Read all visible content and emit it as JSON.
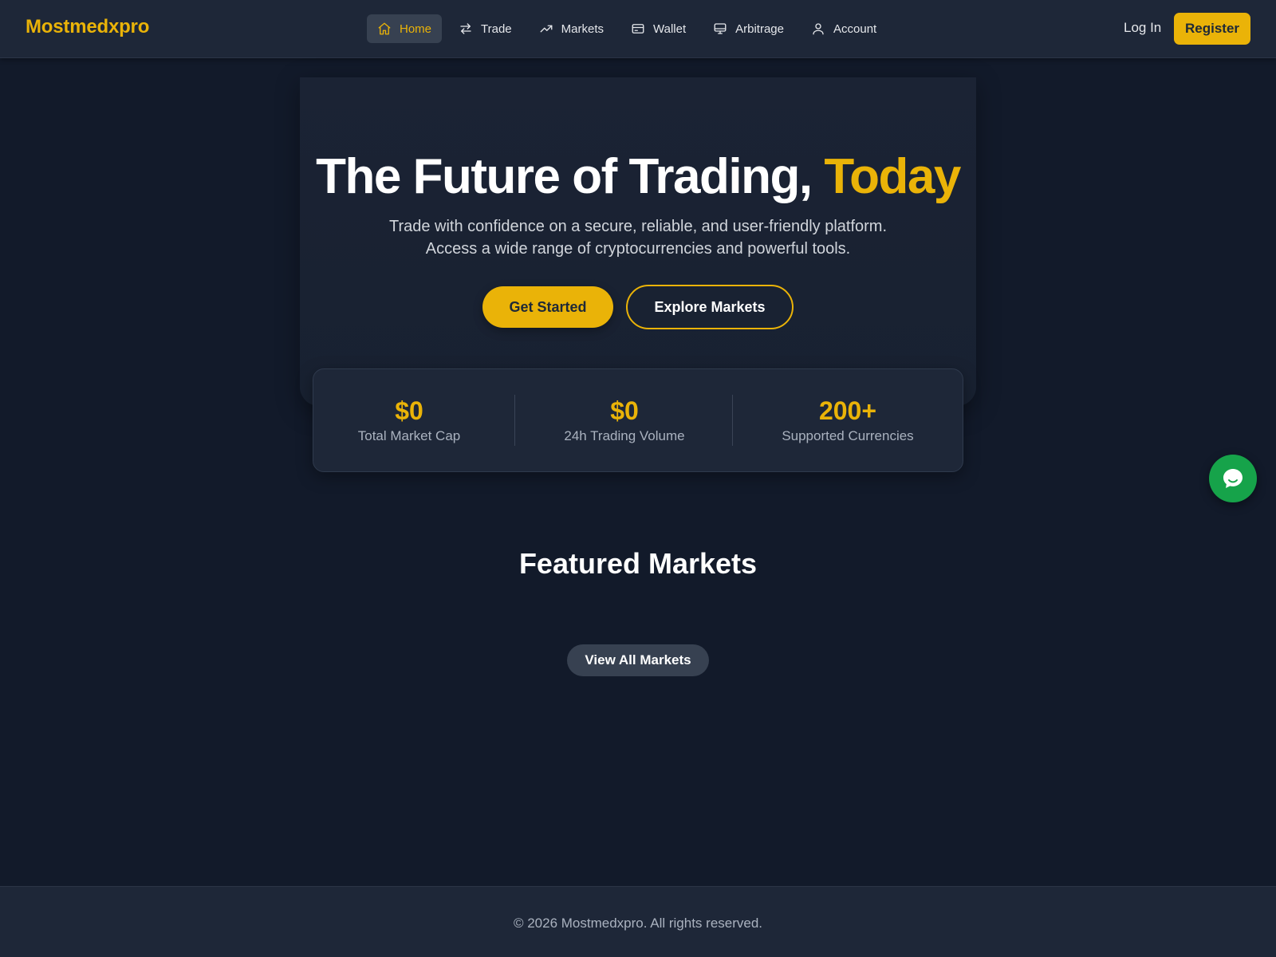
{
  "app": {
    "brand": "Mostmedxpro"
  },
  "nav": {
    "items": [
      {
        "label": "Home",
        "icon": "home-icon",
        "active": true
      },
      {
        "label": "Trade",
        "icon": "arrows-swap-icon"
      },
      {
        "label": "Markets",
        "icon": "trending-up-icon"
      },
      {
        "label": "Wallet",
        "icon": "wallet-card-icon"
      },
      {
        "label": "Arbitrage",
        "icon": "monitor-icon"
      },
      {
        "label": "Account",
        "icon": "user-icon"
      }
    ],
    "login_label": "Log In",
    "register_label": "Register"
  },
  "hero": {
    "title_main": "The Future of Trading, ",
    "title_accent": "Today",
    "subtitle_line1": "Trade with confidence on a secure, reliable, and user-friendly platform.",
    "subtitle_line2": "Access a wide range of cryptocurrencies and powerful tools.",
    "primary_button": "Get Started",
    "secondary_button": "Explore Markets"
  },
  "stats": [
    {
      "value": "$0",
      "label": "Total Market Cap"
    },
    {
      "value": "$0",
      "label": "24h Trading Volume"
    },
    {
      "value": "200+",
      "label": "Supported Currencies"
    }
  ],
  "featured": {
    "title": "Featured Markets",
    "view_all_label": "View All Markets"
  },
  "chat": {
    "icon": "chat-bubble-icon"
  },
  "footer": {
    "text": "© 2026 Mostmedxpro. All rights reserved."
  },
  "colors": {
    "accent": "#eab308",
    "background": "#121a2a",
    "surface": "#1e2738",
    "chat": "#16a34a"
  }
}
